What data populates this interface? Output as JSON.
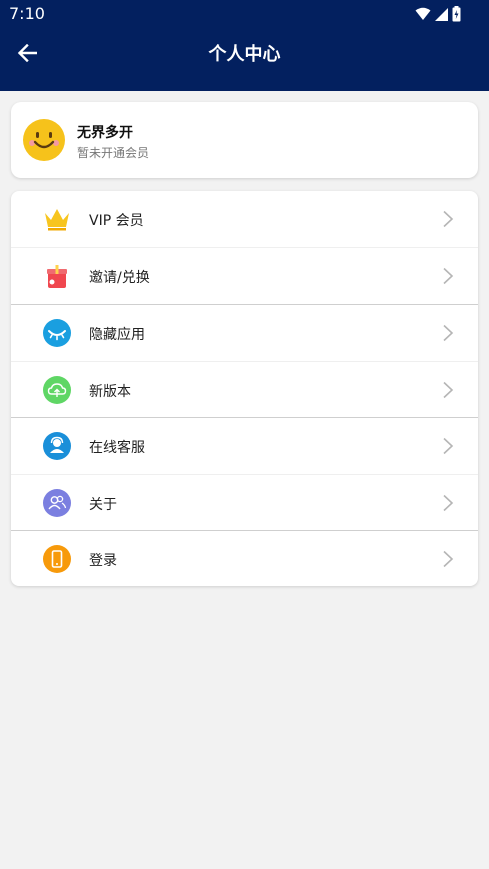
{
  "status_bar": {
    "time": "7:10"
  },
  "header": {
    "title": "个人中心",
    "background": "#03205f"
  },
  "profile": {
    "name": "无界多开",
    "status": "暂未开通会员"
  },
  "menu": {
    "items": [
      {
        "label": "VIP 会员",
        "icon": "crown-icon"
      },
      {
        "label": "邀请/兑换",
        "icon": "gift-icon"
      },
      {
        "label": "隐藏应用",
        "icon": "closed-eye-icon"
      },
      {
        "label": "新版本",
        "icon": "cloud-upload-icon"
      },
      {
        "label": "在线客服",
        "icon": "customer-service-icon"
      },
      {
        "label": "关于",
        "icon": "people-icon"
      },
      {
        "label": "登录",
        "icon": "phone-icon"
      }
    ]
  }
}
